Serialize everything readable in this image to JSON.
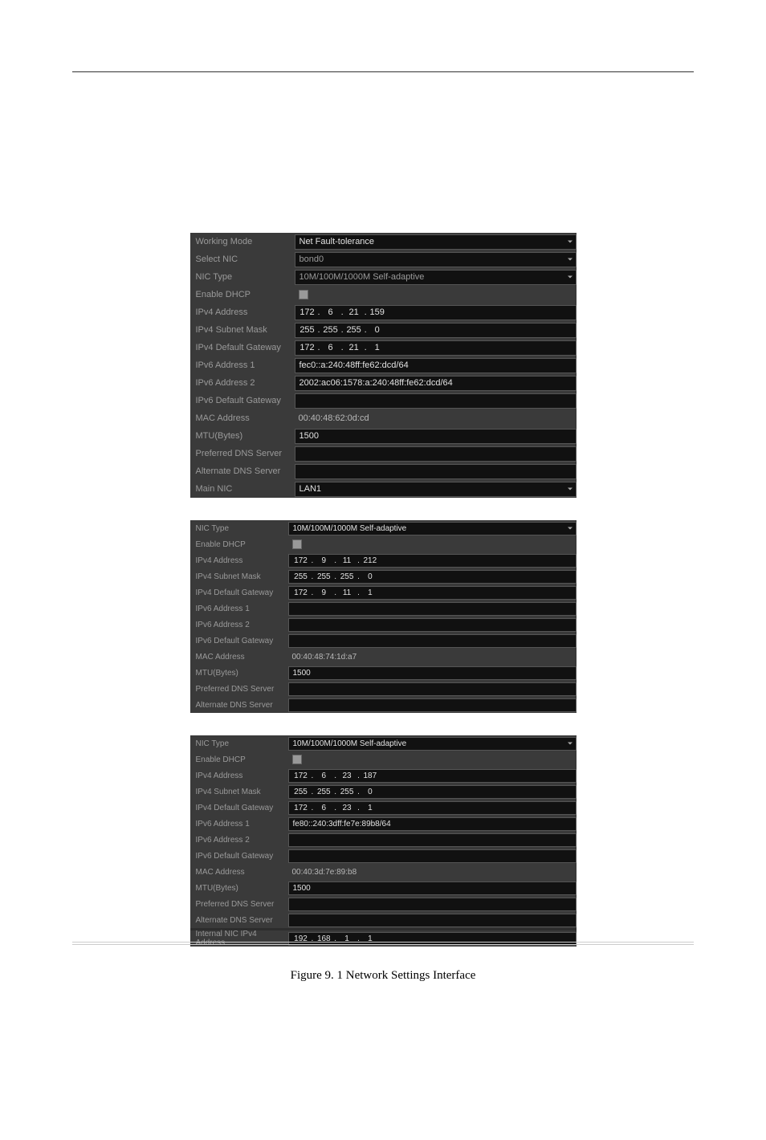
{
  "caption": "Figure 9. 1  Network Settings Interface",
  "panel1": {
    "working_mode_label": "Working Mode",
    "working_mode_value": "Net Fault-tolerance",
    "select_nic_label": "Select NIC",
    "select_nic_value": "bond0",
    "nic_type_label": "NIC Type",
    "nic_type_value": "10M/100M/1000M Self-adaptive",
    "enable_dhcp_label": "Enable DHCP",
    "ipv4_addr_label": "IPv4 Address",
    "ipv4_addr": [
      "172",
      "6",
      "21",
      "159"
    ],
    "ipv4_mask_label": "IPv4 Subnet Mask",
    "ipv4_mask": [
      "255",
      "255",
      "255",
      "0"
    ],
    "ipv4_gw_label": "IPv4 Default Gateway",
    "ipv4_gw": [
      "172",
      "6",
      "21",
      "1"
    ],
    "ipv6_addr1_label": "IPv6 Address 1",
    "ipv6_addr1_value": "fec0::a:240:48ff:fe62:dcd/64",
    "ipv6_addr2_label": "IPv6 Address 2",
    "ipv6_addr2_value": "2002:ac06:1578:a:240:48ff:fe62:dcd/64",
    "ipv6_gw_label": "IPv6 Default Gateway",
    "ipv6_gw_value": "",
    "mac_label": "MAC Address",
    "mac_value": "00:40:48:62:0d:cd",
    "mtu_label": "MTU(Bytes)",
    "mtu_value": "1500",
    "pref_dns_label": "Preferred DNS Server",
    "pref_dns_value": "",
    "alt_dns_label": "Alternate DNS Server",
    "alt_dns_value": "",
    "main_nic_label": "Main NIC",
    "main_nic_value": "LAN1"
  },
  "panel2": {
    "nic_type_label": "NIC Type",
    "nic_type_value": "10M/100M/1000M Self-adaptive",
    "enable_dhcp_label": "Enable DHCP",
    "ipv4_addr_label": "IPv4 Address",
    "ipv4_addr": [
      "172",
      "9",
      "11",
      "212"
    ],
    "ipv4_mask_label": "IPv4 Subnet Mask",
    "ipv4_mask": [
      "255",
      "255",
      "255",
      "0"
    ],
    "ipv4_gw_label": "IPv4 Default Gateway",
    "ipv4_gw": [
      "172",
      "9",
      "11",
      "1"
    ],
    "ipv6_addr1_label": "IPv6 Address 1",
    "ipv6_addr1_value": "",
    "ipv6_addr2_label": "IPv6 Address 2",
    "ipv6_addr2_value": "",
    "ipv6_gw_label": "IPv6 Default Gateway",
    "ipv6_gw_value": "",
    "mac_label": "MAC Address",
    "mac_value": "00:40:48:74:1d:a7",
    "mtu_label": "MTU(Bytes)",
    "mtu_value": "1500",
    "pref_dns_label": "Preferred DNS Server",
    "pref_dns_value": "",
    "alt_dns_label": "Alternate DNS Server",
    "alt_dns_value": ""
  },
  "panel3": {
    "nic_type_label": "NIC Type",
    "nic_type_value": "10M/100M/1000M Self-adaptive",
    "enable_dhcp_label": "Enable DHCP",
    "ipv4_addr_label": "IPv4 Address",
    "ipv4_addr": [
      "172",
      "6",
      "23",
      "187"
    ],
    "ipv4_mask_label": "IPv4 Subnet Mask",
    "ipv4_mask": [
      "255",
      "255",
      "255",
      "0"
    ],
    "ipv4_gw_label": "IPv4 Default Gateway",
    "ipv4_gw": [
      "172",
      "6",
      "23",
      "1"
    ],
    "ipv6_addr1_label": "IPv6 Address 1",
    "ipv6_addr1_value": "fe80::240:3dff:fe7e:89b8/64",
    "ipv6_addr2_label": "IPv6 Address 2",
    "ipv6_addr2_value": "",
    "ipv6_gw_label": "IPv6 Default Gateway",
    "ipv6_gw_value": "",
    "mac_label": "MAC Address",
    "mac_value": "00:40:3d:7e:89:b8",
    "mtu_label": "MTU(Bytes)",
    "mtu_value": "1500",
    "pref_dns_label": "Preferred DNS Server",
    "pref_dns_value": "",
    "alt_dns_label": "Alternate DNS Server",
    "alt_dns_value": "",
    "internal_nic_label": "Internal NIC IPv4 Address",
    "internal_nic_ip": [
      "192",
      "168",
      "1",
      "1"
    ]
  }
}
